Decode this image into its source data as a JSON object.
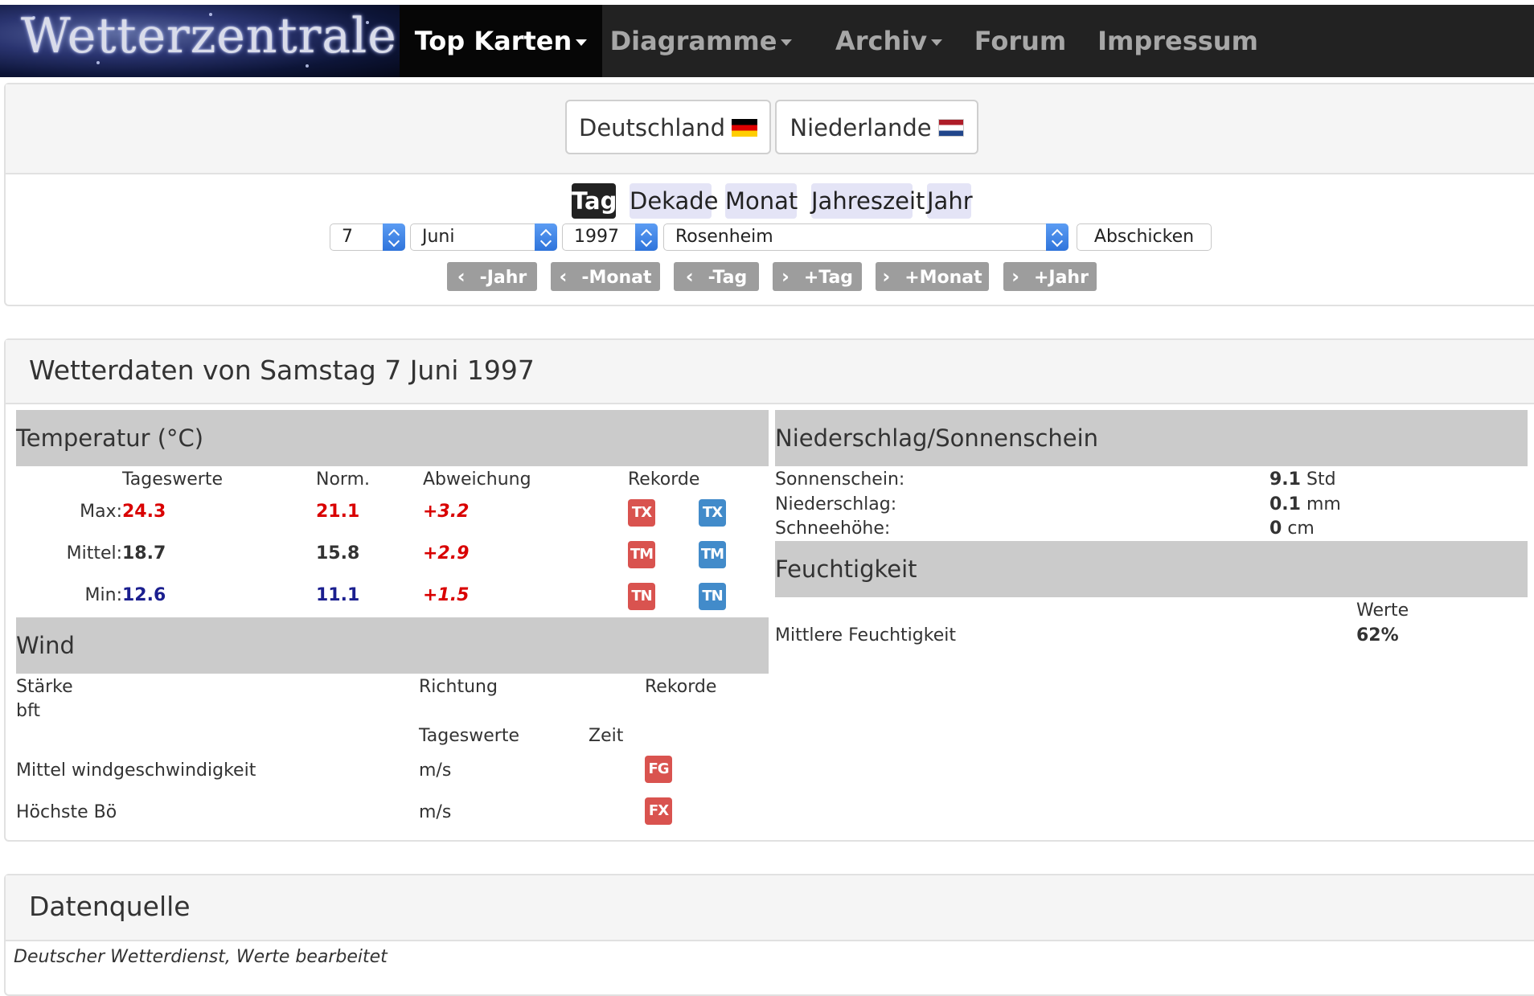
{
  "navbar": {
    "logo_text": "Wetterzentrale",
    "items": [
      {
        "label": "Top Karten",
        "active": true,
        "dropdown": true
      },
      {
        "label": "Diagramme",
        "active": false,
        "dropdown": true
      },
      {
        "label": "Archiv",
        "active": false,
        "dropdown": true
      },
      {
        "label": "Forum",
        "active": false,
        "dropdown": false
      },
      {
        "label": "Impressum",
        "active": false,
        "dropdown": false
      }
    ]
  },
  "countries": [
    "Deutschland",
    "Niederlande"
  ],
  "periods": [
    "Tag",
    "Dekade",
    "Monat",
    "Jahreszeit",
    "Jahr"
  ],
  "form": {
    "day": "7",
    "month": "Juni",
    "year": "1997",
    "station": "Rosenheim",
    "submit_label": "Abschicken"
  },
  "step_buttons": [
    "-Jahr",
    "-Monat",
    "-Tag",
    "+Tag",
    "+Monat",
    "+Jahr"
  ],
  "weather": {
    "title": "Wetterdaten von Samstag 7 Juni 1997",
    "temperature": {
      "heading": "Temperatur (°C)",
      "col_tageswerte": "Tageswerte",
      "col_norm": "Norm.",
      "col_abweichung": "Abweichung",
      "col_rekorde": "Rekorde",
      "rows": [
        {
          "label": "Max:",
          "value": "24.3",
          "norm": "21.1",
          "dev": "+3.2",
          "code": "TX"
        },
        {
          "label": "Mittel:",
          "value": "18.7",
          "norm": "15.8",
          "dev": "+2.9",
          "code": "TM"
        },
        {
          "label": "Min:",
          "value": "12.6",
          "norm": "11.1",
          "dev": "+1.5",
          "code": "TN"
        }
      ]
    },
    "wind": {
      "heading": "Wind",
      "col_staerke": "Stärke",
      "col_bft": "bft",
      "col_richtung": "Richtung",
      "col_rekorde": "Rekorde",
      "col_tageswerte": "Tageswerte",
      "col_zeit": "Zeit",
      "rows": [
        {
          "label": "Mittel windgeschwindigkeit",
          "unit": "m/s",
          "code": "FG"
        },
        {
          "label": "Höchste Bö",
          "unit": "m/s",
          "code": "FX"
        }
      ]
    },
    "precip": {
      "heading": "Niederschlag/Sonnenschein",
      "rows": [
        {
          "label": "Sonnenschein:",
          "value": "9.1",
          "unit": "Std"
        },
        {
          "label": "Niederschlag:",
          "value": "0.1",
          "unit": "mm"
        },
        {
          "label": "Schneehöhe:",
          "value": "0",
          "unit": "cm"
        }
      ]
    },
    "humidity": {
      "heading": "Feuchtigkeit",
      "col_werte": "Werte",
      "label": "Mittlere Feuchtigkeit",
      "value": "62%"
    }
  },
  "source": {
    "title": "Datenquelle",
    "text": "Deutscher Wetterdienst, Werte bearbeitet"
  },
  "colors": {
    "navbar": "#222222",
    "record_red": "#d9534f",
    "record_blue": "#428bca",
    "value_red": "#d90000",
    "value_navy": "#1b1f8f"
  }
}
